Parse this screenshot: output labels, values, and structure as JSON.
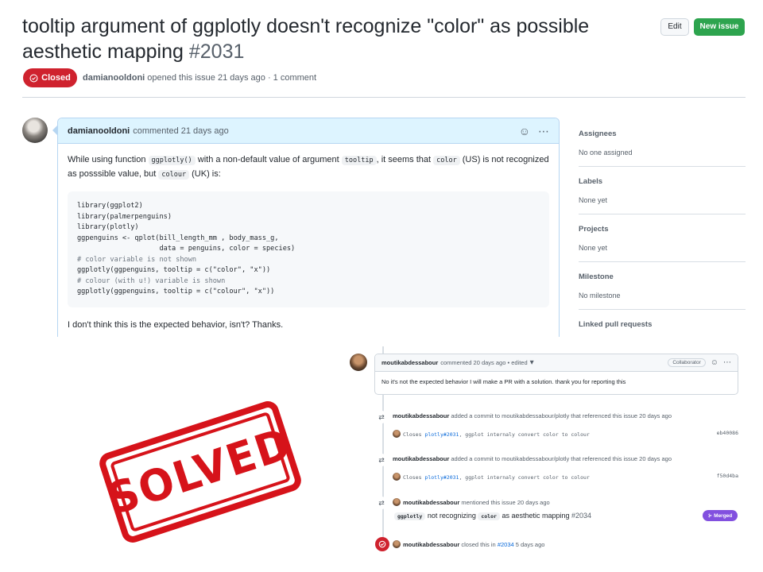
{
  "issue": {
    "title": "tooltip argument of ggplotly doesn't recognize \"color\" as possible aesthetic mapping",
    "number": "#2031",
    "state": "Closed",
    "author": "damianooldoni",
    "meta_rest": "opened this issue 21 days ago · 1 comment"
  },
  "actions": {
    "edit": "Edit",
    "new_issue": "New issue"
  },
  "comment": {
    "author": "damianooldoni",
    "action": "commented 21 days ago",
    "intro_1": "While using function ",
    "code_1": "ggplotly()",
    "intro_2": " with a non-default value of argument ",
    "code_2": "tooltip",
    "intro_3": ", it seems that ",
    "code_3": "color",
    "intro_4": " (US) is not recognized as posssible value, but ",
    "code_4": "colour",
    "intro_5": " (UK) is:",
    "code_lines": [
      "library(ggplot2)",
      "library(palmerpenguins)",
      "library(plotly)",
      "ggpenguins <- qplot(bill_length_mm , body_mass_g,",
      "                    data = penguins, color = species)",
      "# color variable is not shown",
      "ggplotly(ggpenguins, tooltip = c(\"color\", \"x\"))",
      "# colour (with u!) variable is shown",
      "ggplotly(ggpenguins, tooltip = c(\"colour\", \"x\"))"
    ],
    "closing": "I don't think this is the expected behavior, isn't? Thanks."
  },
  "sidebar": {
    "sections": [
      {
        "title": "Assignees",
        "value": "No one assigned"
      },
      {
        "title": "Labels",
        "value": "None yet"
      },
      {
        "title": "Projects",
        "value": "None yet"
      },
      {
        "title": "Milestone",
        "value": "No milestone"
      },
      {
        "title": "Linked pull requests",
        "value": ""
      }
    ]
  },
  "reply": {
    "author": "moutikabdessabour",
    "action": "commented 20 days ago • edited",
    "badge": "Collaborator",
    "body": "No it's not the expected behavior I will make a PR with a solution. thank you for reporting this"
  },
  "timeline": {
    "commit_event_1": {
      "author": "moutikabdessabour",
      "text": "added a commit to moutikabdessabour/plotly that referenced this issue 20 days ago"
    },
    "commit_1": {
      "prefix": "Closes ",
      "link": "plotly#2031",
      "msg": ", ggplot internaly convert color to colour",
      "sha": "eb40086"
    },
    "commit_event_2": {
      "author": "moutikabdessabour",
      "text": "added a commit to moutikabdessabour/plotly that referenced this issue 20 days ago"
    },
    "commit_2": {
      "prefix": "Closes ",
      "link": "plotly#2031",
      "msg": ", ggplot internaly convert color to colour",
      "sha": "f50d4ba"
    },
    "mention_event": {
      "author": "moutikabdessabour",
      "text": "mentioned this issue 20 days ago"
    },
    "pr": {
      "code_1": "ggplotly",
      "text_1": " not recognizing ",
      "code_2": "color",
      "text_2": " as aesthetic mapping ",
      "number": "#2034",
      "badge": "Merged"
    },
    "closed_event": {
      "author": "moutikabdessabour",
      "text_1": "closed this in ",
      "link": "#2034",
      "text_2": " 5 days ago"
    }
  },
  "stamp": {
    "text": "SOLVED"
  },
  "colors": {
    "closed_red": "#cf222e",
    "green": "#2da44e",
    "merged_purple": "#8250df",
    "stamp_red": "#d6131a"
  }
}
